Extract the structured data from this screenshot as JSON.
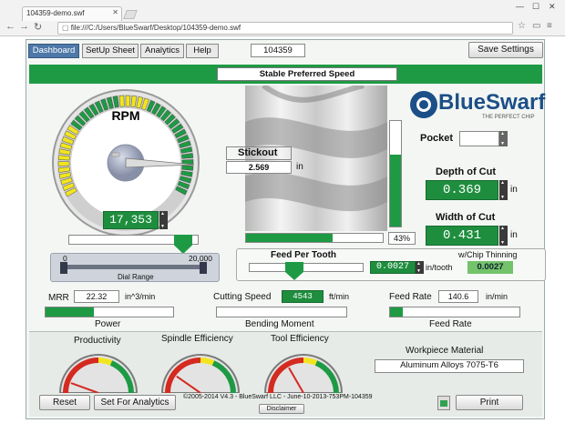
{
  "browser": {
    "tab_title": "104359-demo.swf",
    "address": "file:///C:/Users/BlueSwarf/Desktop/104359-demo.swf"
  },
  "nav": {
    "tabs": [
      "Dashboard",
      "SetUp Sheet",
      "Analytics",
      "Help"
    ],
    "active": "Dashboard",
    "job_number": "104359",
    "save_label": "Save Settings"
  },
  "banner": "Stable Preferred Speed",
  "rpm": {
    "title": "RPM",
    "value": "17,353",
    "dial_range_label": "Dial Range",
    "dial_min": "0",
    "dial_max": "20,000"
  },
  "logo": {
    "brand": "BlueSwarf",
    "tagline": "THE PERFECT CHIP"
  },
  "stickout": {
    "label": "Stickout",
    "value": "2.569",
    "unit": "in"
  },
  "engagement_pct": "43%",
  "pocket": {
    "label": "Pocket",
    "value": ""
  },
  "depth_of_cut": {
    "label": "Depth of Cut",
    "value": "0.369",
    "unit": "in"
  },
  "width_of_cut": {
    "label": "Width of Cut",
    "value": "0.431",
    "unit": "in"
  },
  "feed_per_tooth": {
    "label": "Feed Per Tooth",
    "value": "0.0027",
    "unit": "in/tooth"
  },
  "chip_thinning": {
    "label": "w/Chip Thinning",
    "value": "0.0027"
  },
  "mrr": {
    "label": "MRR",
    "value": "22.32",
    "unit": "in^3/min",
    "bar_label": "Power",
    "power_level": 0.38
  },
  "cutting_speed": {
    "label": "Cutting Speed",
    "value": "4543",
    "unit": "ft/min",
    "bar_label": "Bending Moment"
  },
  "feed_rate": {
    "label": "Feed Rate",
    "value": "140.6",
    "unit": "in/min",
    "bar_label": "Feed Rate",
    "level": 0.1
  },
  "gauges": {
    "productivity": "Productivity",
    "spindle": "Spindle Efficiency",
    "tool": "Tool Efficiency"
  },
  "material": {
    "label": "Workpiece Material",
    "value": "Aluminum Alloys 7075-T6"
  },
  "footer": {
    "reset": "Reset",
    "set_analytics": "Set For Analytics",
    "copyright": "©2005-2014 V4.3 - BlueSwarf LLC - June-10-2013-753PM-104359",
    "disclaimer": "Disclaimer",
    "print": "Print"
  },
  "colors": {
    "accent_green": "#1e9a44",
    "tab_blue": "#4d78a8",
    "gauge_red": "#d42a20",
    "gauge_yellow": "#f2e51f"
  }
}
